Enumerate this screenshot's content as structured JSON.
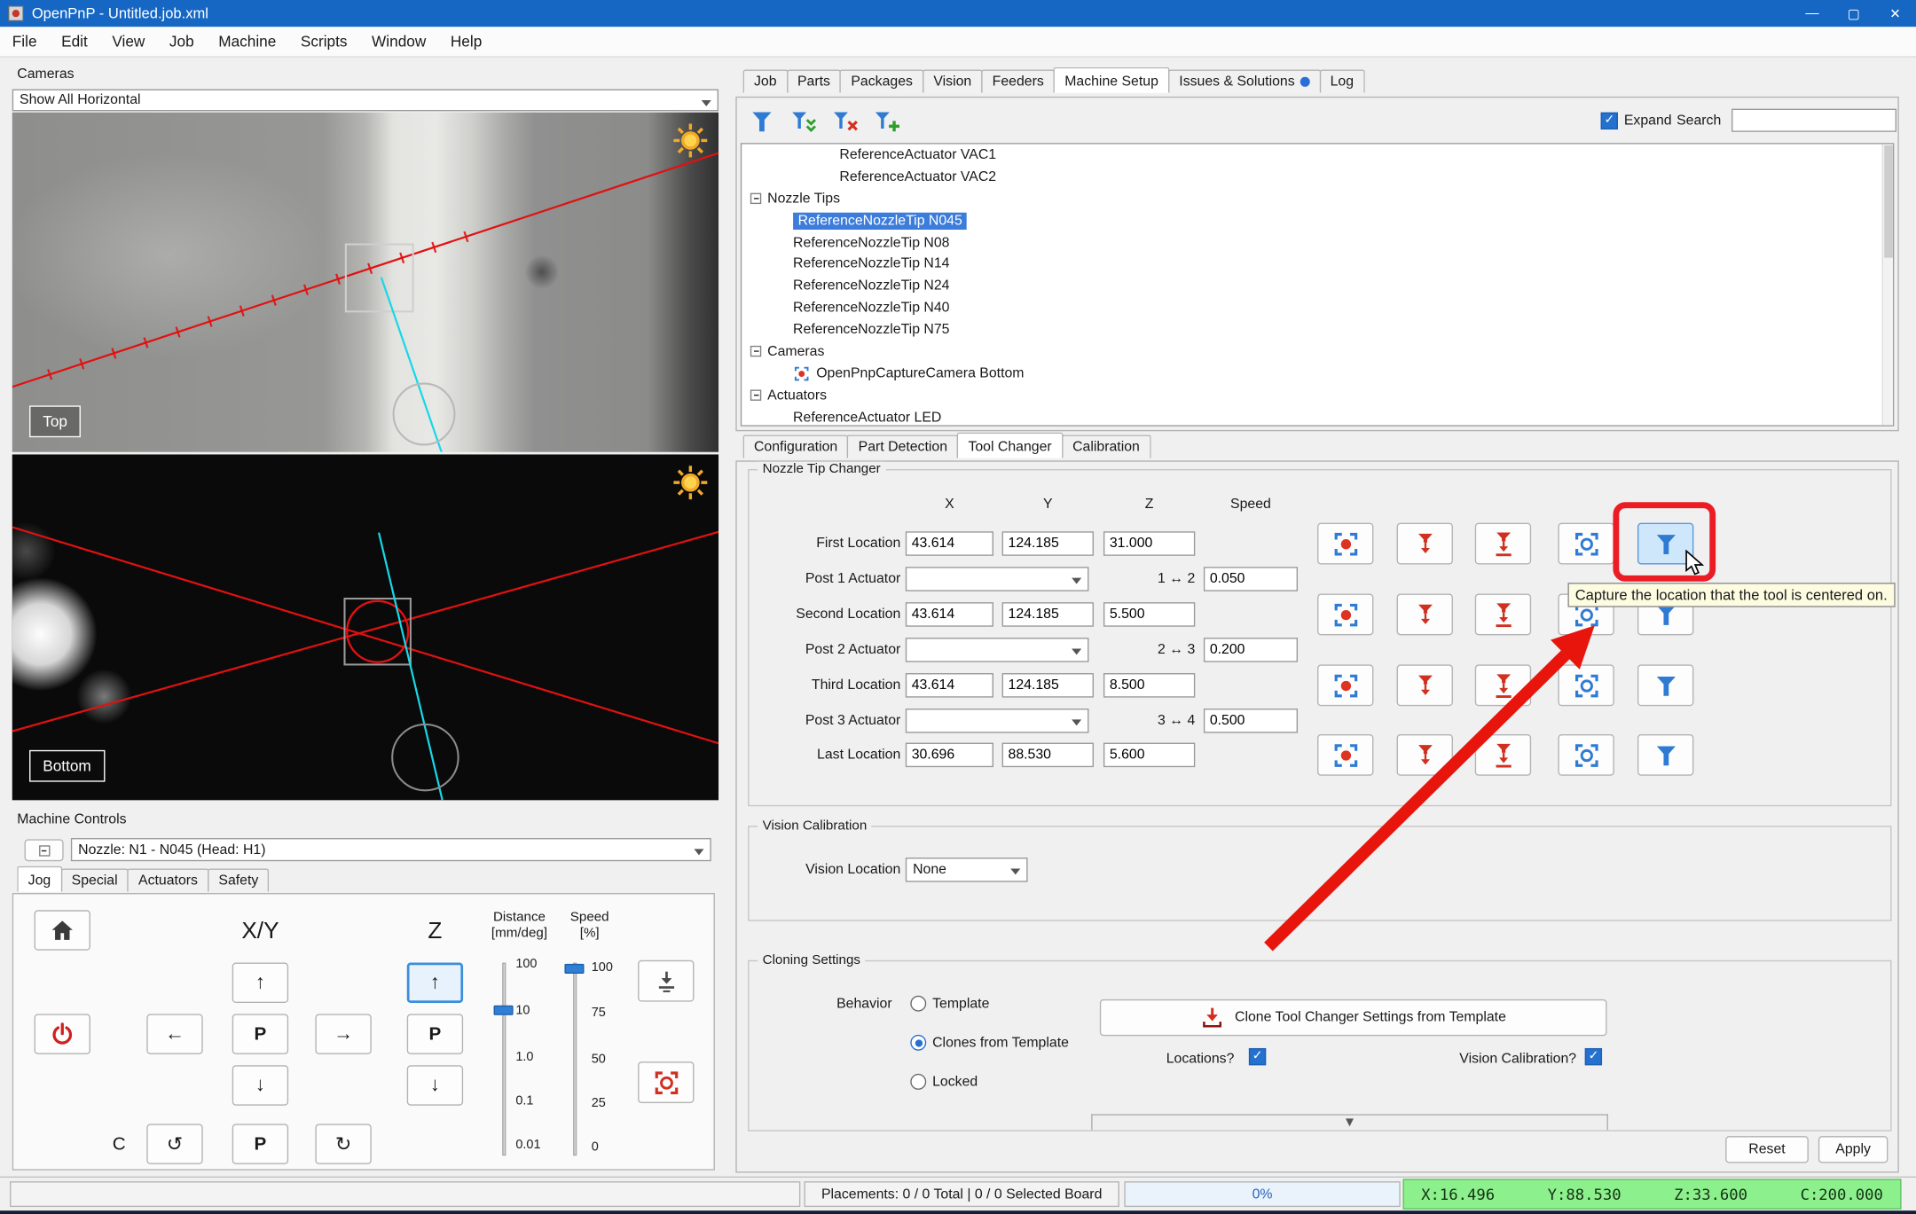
{
  "titlebar": {
    "title": "OpenPnP - Untitled.job.xml"
  },
  "window_controls": {
    "minimize": "—",
    "maximize": "▢",
    "close": "✕"
  },
  "menu": {
    "items": [
      "File",
      "Edit",
      "View",
      "Job",
      "Machine",
      "Scripts",
      "Window",
      "Help"
    ]
  },
  "cameras_panel": {
    "title": "Cameras",
    "camera_selector": "Show All Horizontal",
    "top_label": "Top",
    "bottom_label": "Bottom"
  },
  "machine_controls": {
    "title": "Machine Controls",
    "nozzle_selector": "Nozzle: N1 - N045 (Head: H1)",
    "tabs": [
      "Jog",
      "Special",
      "Actuators",
      "Safety"
    ],
    "xy_label": "X/Y",
    "z_label": "Z",
    "c_label": "C",
    "p_button": "P",
    "distance_label": "Distance",
    "distance_unit": "[mm/deg]",
    "speed_label": "Speed",
    "speed_unit": "[%]",
    "distance_ticks": [
      "100",
      "10",
      "1.0",
      "0.1",
      "0.01"
    ],
    "speed_ticks": [
      "100",
      "75",
      "50",
      "25",
      "0"
    ]
  },
  "main_tabs": {
    "items": [
      "Job",
      "Parts",
      "Packages",
      "Vision",
      "Feeders",
      "Machine Setup",
      "Issues & Solutions",
      "Log"
    ],
    "active": "Machine Setup"
  },
  "tree_toolbar": {
    "expand_label": "Expand",
    "search_label": "Search",
    "search_value": ""
  },
  "tree": {
    "items": [
      "ReferenceActuator VAC1",
      "ReferenceActuator VAC2",
      "Nozzle Tips",
      "ReferenceNozzleTip N045",
      "ReferenceNozzleTip N08",
      "ReferenceNozzleTip N14",
      "ReferenceNozzleTip N24",
      "ReferenceNozzleTip N40",
      "ReferenceNozzleTip N75",
      "Cameras",
      "OpenPnpCaptureCamera Bottom",
      "Actuators",
      "ReferenceActuator LED"
    ]
  },
  "config_tabs": {
    "items": [
      "Configuration",
      "Part Detection",
      "Tool Changer",
      "Calibration"
    ],
    "active": "Tool Changer"
  },
  "nozzle_tip_changer": {
    "title": "Nozzle Tip Changer",
    "headers": {
      "x": "X",
      "y": "Y",
      "z": "Z",
      "speed": "Speed"
    },
    "first": {
      "label": "First Location",
      "x": "43.614",
      "y": "124.185",
      "z": "31.000"
    },
    "post1": {
      "label": "Post 1 Actuator",
      "value": "",
      "range": "1 ↔ 2",
      "speed": "0.050"
    },
    "second": {
      "label": "Second Location",
      "x": "43.614",
      "y": "124.185",
      "z": "5.500"
    },
    "post2": {
      "label": "Post 2 Actuator",
      "value": "",
      "range": "2 ↔ 3",
      "speed": "0.200"
    },
    "third": {
      "label": "Third Location",
      "x": "43.614",
      "y": "124.185",
      "z": "8.500"
    },
    "post3": {
      "label": "Post 3 Actuator",
      "value": "",
      "range": "3 ↔ 4",
      "speed": "0.500"
    },
    "last": {
      "label": "Last Location",
      "x": "30.696",
      "y": "88.530",
      "z": "5.600"
    }
  },
  "vision_calibration": {
    "title": "Vision Calibration",
    "location_label": "Vision Location",
    "location_value": "None"
  },
  "cloning": {
    "title": "Cloning Settings",
    "behavior_label": "Behavior",
    "option_template": "Template",
    "option_clones": "Clones from Template",
    "option_locked": "Locked",
    "clone_button": "Clone Tool Changer Settings from Template",
    "locations_label": "Locations?",
    "vision_label": "Vision Calibration?"
  },
  "actions": {
    "reset": "Reset",
    "apply": "Apply"
  },
  "statusbar": {
    "placements": "Placements: 0 / 0 Total | 0 / 0 Selected Board",
    "progress": "0%",
    "coords": {
      "x": "X:16.496",
      "y": "Y:88.530",
      "z": "Z:33.600",
      "c": "C:200.000"
    }
  },
  "annotation": {
    "tooltip": "Capture the location that the tool is centered on."
  }
}
